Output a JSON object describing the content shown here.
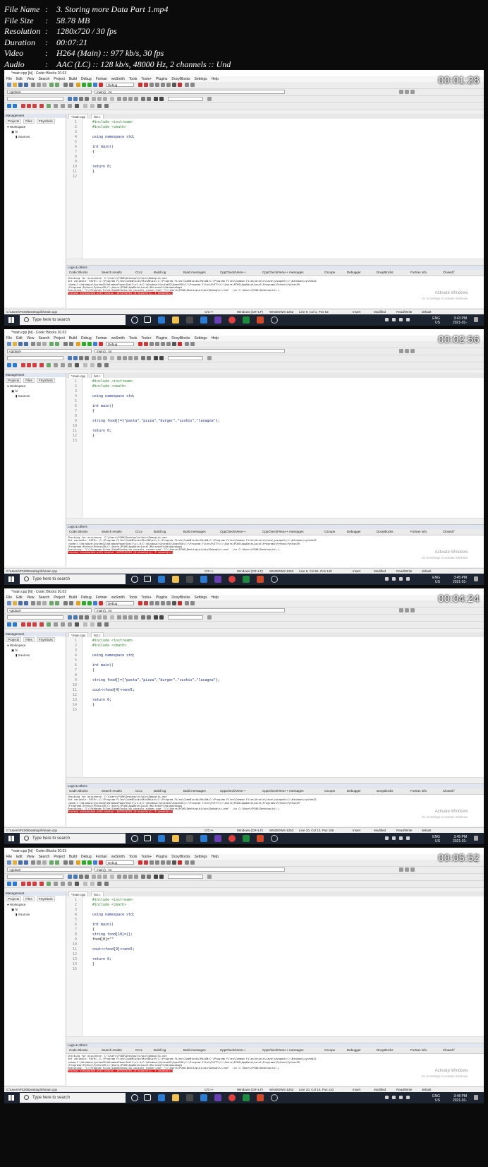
{
  "info": {
    "file_name": {
      "key": "File Name",
      "value": "3. Storing more Data Part 1.mp4"
    },
    "file_size": {
      "key": "File Size",
      "value": "58.78 MB"
    },
    "resolution": {
      "key": "Resolution",
      "value": "1280x720 / 30 fps"
    },
    "duration": {
      "key": "Duration",
      "value": "00:07:21"
    },
    "video": {
      "key": "Video",
      "value": "H264 (Main) :: 977 kb/s, 30 fps"
    },
    "audio": {
      "key": "Audio",
      "value": "AAC (LC) :: 128 kb/s, 48000 Hz, 2 channels :: Und"
    },
    "separator": ":"
  },
  "common": {
    "window_title": "*main.cpp [hi] - Code::Blocks 20.03",
    "menu": [
      "File",
      "Edit",
      "View",
      "Search",
      "Project",
      "Build",
      "Debug",
      "Fortran",
      "wxSmith",
      "Tools",
      "Tools+",
      "Plugins",
      "DoxyBlocks",
      "Settings",
      "Help"
    ],
    "build_target": "Debug",
    "scope": "<global>",
    "symbol": "main() : int",
    "management_title": "Management",
    "mgmt_tabs": [
      "Projects",
      "Files",
      "FSymbols"
    ],
    "tree": [
      "Workspace",
      "hi",
      "Sources"
    ],
    "editor_tabs": [
      "*main.cpp",
      "hi2.c"
    ],
    "logs_title": "Logs & others",
    "log_tabs": [
      "Code::Blocks",
      "Search results",
      "Cccc",
      "Build log",
      "Build messages",
      "CppCheck/Vera++",
      "CppCheck/Vera++ messages",
      "Cscope",
      "Debugger",
      "DoxyBlocks",
      "Fortran info",
      "Closed f"
    ],
    "activate_title": "Activate Windows",
    "activate_sub": "Go to Settings to activate Windows.",
    "status_path": "C:\\Users\\PC00\\Desktop\\hi\\main.cpp",
    "status_lang": "C/C++",
    "status_eol": "Windows (CR+LF)",
    "status_enc": "WINDOWS-1252",
    "status_mode": "Insert",
    "status_mod": "Modified",
    "status_rw": "Read/Write",
    "status_default": "default",
    "taskbar_search": "Type here to search",
    "tray_lang": "ENG",
    "tray_region": "US"
  },
  "frames": [
    {
      "timestamp": "00:01:28",
      "lines": [
        "#include <iostream>",
        "#include <cmath>",
        "",
        "using namespace std;",
        "",
        "int main()",
        "{",
        "",
        "",
        "return 0;",
        "}",
        ""
      ],
      "cursor": "Line 9, Col 1, Pos 62",
      "clock": "3:43 PM",
      "date": "2021-01-",
      "log": [
        "Checking for existence: C:\\Users\\PC00\\Desktop\\hi\\bin\\Debug\\hi.exe",
        "Set variable: PATH=.;C:\\Program Files\\CodeBlocks\\MinGW\\bin;C:\\Program Files\\CodeBlocks\\MinGW;C:\\Program Files\\Common Files\\Oracle\\Java\\javapath;C:\\Windows\\system32",
        "\\vbem;C:\\Windows\\System32\\WindowsPowerShell\\v1.0;C:\\Windows\\System32\\OpenSSH;C:\\Program Files\\PuTTY;C:\\Users\\PC00\\AppData\\Local\\Programs\\Python\\Python39",
        "\\Programs\\Python\\Python39;C:\\Users\\PC00\\AppData\\Local\\Microsoft\\WindowsApps",
        "Executing: \"C:\\Program Files\\CodeBlocks/cb_console_runner.exe\" \"C:\\Users\\PC00\\Desktop\\hi\\bin\\Debug\\hi.exe\"  (in C:\\Users\\PC00\\Desktop\\hi\\.)"
      ],
      "log_error": "Process terminated with status -1073741510 (0 minute(s), 1 second(s))"
    },
    {
      "timestamp": "00:02:56",
      "lines": [
        "#include <iostream>",
        "#include <cmath>",
        "",
        "using namespace std;",
        "",
        "int main()",
        "{",
        "",
        "string food[]={\"pasta\",\"pizza\",\"burger\",\"sushis\",\"lasagna\"};",
        "",
        "return 0;",
        "}",
        ""
      ],
      "cursor": "Line 8, Col 61, Pos 140",
      "clock": "3:45 PM",
      "date": "2021-01-",
      "log": [
        "Checking for existence: C:\\Users\\PC00\\Desktop\\hi\\bin\\Debug\\hi.exe",
        "Set variable: PATH=.;C:\\Program Files\\CodeBlocks\\MinGW\\bin;C:\\Program Files\\CodeBlocks\\MinGW;C:\\Program Files\\Common Files\\Oracle\\Java\\javapath;C:\\Windows\\system32",
        "\\vbem;C:\\Windows\\System32\\WindowsPowerShell\\v1.0;C:\\Windows\\System32\\OpenSSH;C:\\Program Files\\PuTTY;C:\\Users\\PC00\\AppData\\Local\\Programs\\Python\\Python39",
        "\\Programs\\Python\\Python39;C:\\Users\\PC00\\AppData\\Local\\Microsoft\\WindowsApps",
        "Executing: \"C:\\Program Files\\CodeBlocks/cb_console_runner.exe\" \"C:\\Users\\PC00\\Desktop\\hi\\bin\\Debug\\hi.exe\"  (in C:\\Users\\PC00\\Desktop\\hi\\.)"
      ],
      "log_error": "Process terminated with status -1073741510 (0 minute(s), 3 second(s))"
    },
    {
      "timestamp": "00:04:24",
      "lines": [
        "#include <iostream>",
        "#include <cmath>",
        "",
        "using namespace std;",
        "",
        "int main()",
        "{",
        "",
        "string food[]={\"pasta\",\"pizza\",\"burger\",\"sushis\",\"lasagna\"};",
        "",
        "cout<<food[4]<<endl;",
        "",
        "return 0;",
        "}",
        ""
      ],
      "cursor": "Line 10, Col 13, Pos 156",
      "clock": "3:45 PM",
      "date": "2021-01-",
      "log": [
        "Checking for existence: C:\\Users\\PC00\\Desktop\\hi\\bin\\Debug\\hi.exe",
        "Set variable: PATH=.;C:\\Program Files\\CodeBlocks\\MinGW\\bin;C:\\Program Files\\CodeBlocks\\MinGW;C:\\Program Files\\Common Files\\Oracle\\Java\\javapath;C:\\Windows\\system32",
        "\\vbem;C:\\Windows\\System32\\WindowsPowerShell\\v1.0;C:\\Windows\\System32\\OpenSSH;C:\\Program Files\\PuTTY;C:\\Users\\PC00\\AppData\\Local\\Programs\\Python\\Python39",
        "\\Programs\\Python\\Python39;C:\\Users\\PC00\\AppData\\Local\\Microsoft\\WindowsApps",
        "Executing: \"C:\\Program Files\\CodeBlocks/cb_console_runner.exe\" \"C:\\Users\\PC00\\Desktop\\hi\\bin\\Debug\\hi.exe\"  (in C:\\Users\\PC00\\Desktop\\hi\\.)"
      ],
      "log_error": "Process terminated with status -1073741510 (0 minute(s), 9 second(s))"
    },
    {
      "timestamp": "00:05:52",
      "lines": [
        "#include <iostream>",
        "#include <cmath>",
        "",
        "using namespace std;",
        "",
        "int main()",
        "{",
        "string food[10]={};",
        "food[0]=\"\"",
        "",
        "cout<<food[9]<<endl;",
        "",
        "return 0;",
        "}",
        ""
      ],
      "cursor": "Line 10, Col 10, Pos 110",
      "clock": "3:48 PM",
      "date": "2021-01-",
      "log": [
        "Checking for existence: C:\\Users\\PC00\\Desktop\\hi\\bin\\Debug\\hi.exe",
        "Set variable: PATH=.;C:\\Program Files\\CodeBlocks\\MinGW\\bin;C:\\Program Files\\CodeBlocks\\MinGW;C:\\Program Files\\Common Files\\Oracle\\Java\\javapath;C:\\Windows\\system32",
        "\\vbem;C:\\Windows\\System32\\WindowsPowerShell\\v1.0;C:\\Windows\\System32\\OpenSSH;C:\\Program Files\\PuTTY;C:\\Users\\PC00\\AppData\\Local\\Programs\\Python\\Python39",
        "\\Programs\\Python\\Python39;C:\\Users\\PC00\\AppData\\Local\\Microsoft\\WindowsApps",
        "Executing: \"C:\\Program Files\\CodeBlocks/cb_console_runner.exe\" \"C:\\Users\\PC00\\Desktop\\hi\\bin\\Debug\\hi.exe\"  (in C:\\Users\\PC00\\Desktop\\hi\\.)"
      ],
      "log_error": "Process terminated with status -1073741510 (0 minute(s), 2 second(s))"
    }
  ]
}
